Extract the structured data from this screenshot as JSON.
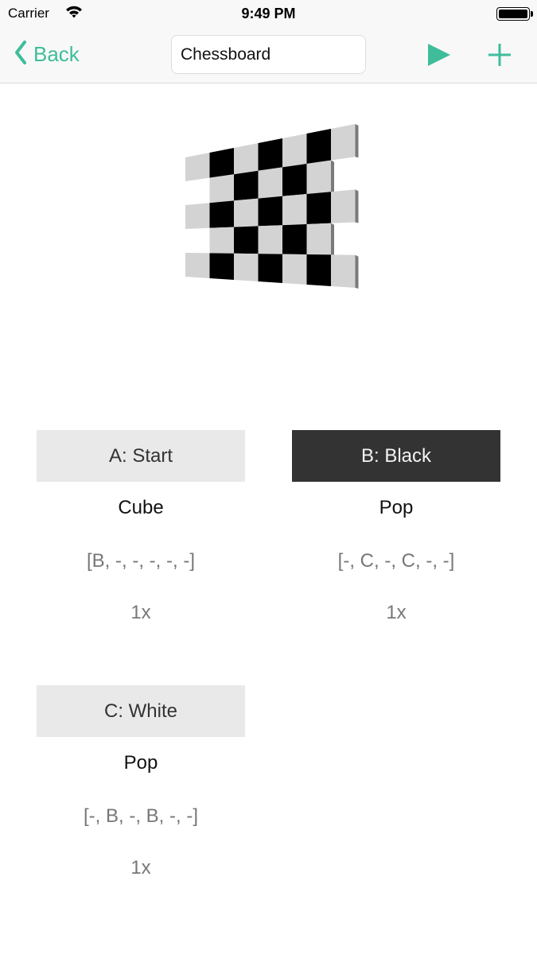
{
  "status_bar": {
    "carrier": "Carrier",
    "time": "9:49 PM",
    "battery_level": 1.0
  },
  "nav": {
    "back_label": "Back",
    "title_value": "Chessboard",
    "play_icon": "play-icon",
    "add_icon": "plus-icon",
    "accent_color": "#3fbd9b"
  },
  "preview": {
    "description": "3D chessboard made of cubes",
    "rows": [
      [
        "light",
        "black",
        "light",
        "black",
        "light",
        "black",
        "light"
      ],
      [
        null,
        "light",
        "black",
        "light",
        "black",
        "light",
        null
      ],
      [
        "light",
        "black",
        "light",
        "black",
        "light",
        "black",
        "light"
      ],
      [
        null,
        "light",
        "black",
        "light",
        "black",
        "light",
        null
      ],
      [
        "light",
        "black",
        "light",
        "black",
        "light",
        "black",
        "light"
      ]
    ]
  },
  "cards": [
    {
      "header": "A: Start",
      "type": "Cube",
      "params": "[B, -, -, -, -, -]",
      "repeat": "1x",
      "selected": false
    },
    {
      "header": "B: Black",
      "type": "Pop",
      "params": "[-, C, -, C, -, -]",
      "repeat": "1x",
      "selected": true
    },
    {
      "header": "C: White",
      "type": "Pop",
      "params": "[-, B, -, B, -, -]",
      "repeat": "1x",
      "selected": false
    }
  ]
}
